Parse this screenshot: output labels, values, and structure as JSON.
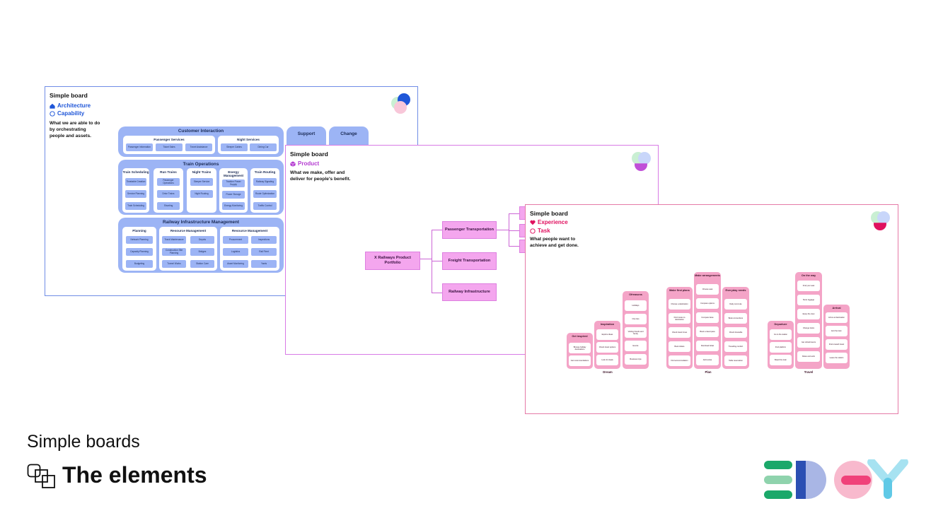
{
  "slide": {
    "subtitle": "Simple boards",
    "title": "The elements"
  },
  "boards": {
    "architecture": {
      "title": "Simple board",
      "type1": "Architecture",
      "type2": "Capability",
      "description": "What we are able to do by orchestrating people and assets.",
      "groups": {
        "customer": {
          "title": "Customer Interaction",
          "cols": {
            "passenger": {
              "title": "Passenger Services",
              "chips": [
                "Passenger information",
                "Ticket Sales",
                "Travel Assistance"
              ]
            },
            "night": {
              "title": "Night Services",
              "chips": [
                "Sleeper Cabins",
                "Dining Car"
              ]
            }
          }
        },
        "operations": {
          "title": "Train Operations",
          "cols": {
            "scheduling": {
              "title": "Train Scheduling",
              "chips": [
                "Timetable Creation",
                "Service Planning",
                "Train Scheduling"
              ]
            },
            "run": {
              "title": "Run Trains",
              "chips": [
                "Passenger Operations",
                "Drive Trains",
                "Shunting"
              ]
            },
            "nighttrains": {
              "title": "Night Trains",
              "chips": [
                "Sleeper Service",
                "Night Routing"
              ]
            },
            "energy": {
              "title": "Energy Management",
              "chips": [
                "Traction Power Supply",
                "Power Storage",
                "Energy Monitoring"
              ]
            },
            "routing": {
              "title": "Train Routing",
              "chips": [
                "Railway Signaling",
                "Route Optimization",
                "Traffic Control"
              ]
            }
          }
        },
        "infra": {
          "title": "Railway Infrastructure Management",
          "cols": {
            "planning": {
              "title": "Planning",
              "chips": [
                "Network Planning",
                "Capacity Planning",
                "Budgeting"
              ]
            },
            "resource1": {
              "title": "Resource Management",
              "chips": [
                "Track Maintenance",
                "Depots",
                "Construction Site Planning",
                "Bridges",
                "Tunnel Works",
                "Station Care"
              ]
            },
            "resource2": {
              "title": "Resource Management",
              "chips": [
                "Procurement",
                "Inspections",
                "Logistics",
                "Rail Fleet",
                "Asset Monitoring",
                "Yards"
              ]
            }
          }
        }
      },
      "side1": "Support",
      "side2": "Change"
    },
    "product": {
      "title": "Simple board",
      "type": "Product",
      "description": "What we make, offer and deliver for people's benefit.",
      "root": "X Railways Product Portfolio",
      "children": [
        "Passenger Transportation",
        "Freight Transportation",
        "Railway Infrastructure"
      ]
    },
    "experience": {
      "title": "Simple board",
      "type1": "Experience",
      "type2": "Task",
      "description": "What people want to achieve and get done.",
      "stages": {
        "s1": {
          "title": "Get inspired",
          "steps": [
            "Browse holiday destinations",
            "Get recommendations"
          ]
        },
        "s2": {
          "title": "Inspiration",
          "steps": [
            "Explore ideas",
            "Check travel options",
            "Look for deals"
          ]
        },
        "s3": {
          "title": "Ofreasons",
          "steps": [
            "Holidays",
            "City trips",
            "Visiting friends and family",
            "Events",
            "Business trips"
          ]
        },
        "s4": {
          "title": "Make first plans",
          "steps": [
            "Choose a destination",
            "Find routes to destination",
            "Check travel times",
            "Book tickets",
            "Find accommodation"
          ]
        },
        "s5": {
          "title": "Make arrangements",
          "steps": [
            "Choose seat",
            "Compare options",
            "Compare fares",
            "Book a travel pass",
            "Download ticket",
            "Add extras"
          ]
        },
        "s6": {
          "title": "Everyday needs",
          "steps": [
            "Daily commute",
            "Book connections",
            "Check timetable",
            "Travelling comfort",
            "Table reservation"
          ]
        },
        "s7": {
          "title": "Departure",
          "steps": [
            "Go to the station",
            "Find platform",
            "Board the train"
          ]
        },
        "s8": {
          "title": "On the way",
          "steps": [
            "Find your seat",
            "Store luggage",
            "Enjoy the view",
            "Change trains",
            "Get refreshments",
            "Relax and work"
          ]
        },
        "s9": {
          "title": "Arrival",
          "steps": [
            "Arrive at destination",
            "Exit the train",
            "Find onward travel",
            "Leave the station"
          ]
        }
      },
      "phases": [
        "Dream",
        "Plan",
        "Travel"
      ]
    }
  },
  "colors": {
    "arch_accent": "#1f56d8",
    "product_accent": "#b43cd1",
    "experience_accent": "#e0115f",
    "edgy_green": "#1ba86a",
    "edgy_blue": "#2b4fb3",
    "edgy_red": "#f0427a",
    "edgy_cyan": "#60c9e6"
  }
}
